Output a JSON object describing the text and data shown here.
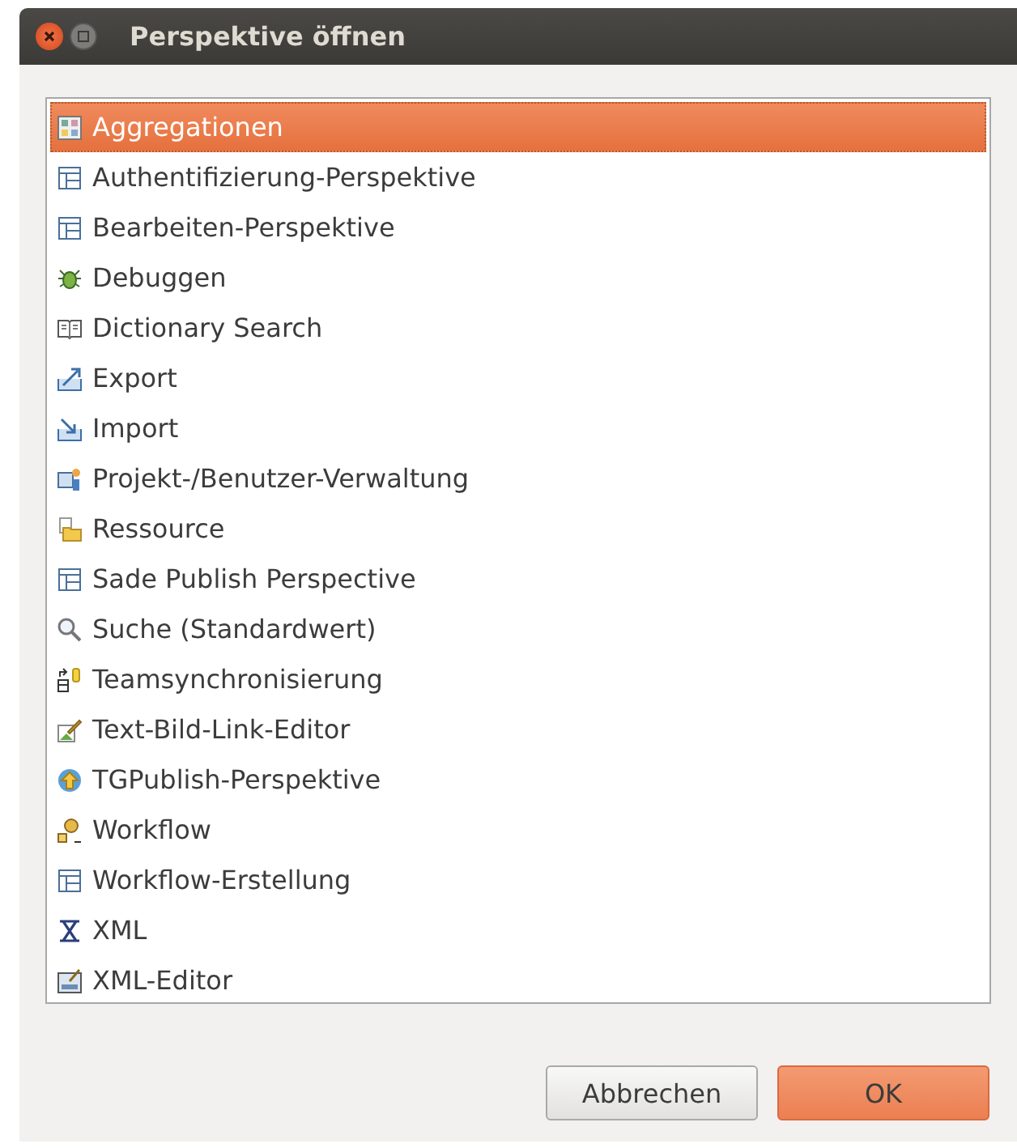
{
  "window": {
    "title": "Perspektive öffnen"
  },
  "perspectives": [
    {
      "label": "Aggregationen",
      "selected": true,
      "kind": "grid"
    },
    {
      "label": "Authentifizierung-Perspektive",
      "selected": false,
      "kind": "table"
    },
    {
      "label": "Bearbeiten-Perspektive",
      "selected": false,
      "kind": "table"
    },
    {
      "label": "Debuggen",
      "selected": false,
      "kind": "bug"
    },
    {
      "label": "Dictionary Search",
      "selected": false,
      "kind": "book"
    },
    {
      "label": "Export",
      "selected": false,
      "kind": "export"
    },
    {
      "label": "Import",
      "selected": false,
      "kind": "import"
    },
    {
      "label": "Projekt-/Benutzer-Verwaltung",
      "selected": false,
      "kind": "users"
    },
    {
      "label": "Ressource",
      "selected": false,
      "kind": "folder"
    },
    {
      "label": "Sade Publish Perspective",
      "selected": false,
      "kind": "table"
    },
    {
      "label": "Suche (Standardwert)",
      "selected": false,
      "kind": "search"
    },
    {
      "label": "Teamsynchronisierung",
      "selected": false,
      "kind": "sync"
    },
    {
      "label": "Text-Bild-Link-Editor",
      "selected": false,
      "kind": "editor"
    },
    {
      "label": "TGPublish-Perspektive",
      "selected": false,
      "kind": "globe"
    },
    {
      "label": "Workflow",
      "selected": false,
      "kind": "workflow"
    },
    {
      "label": "Workflow-Erstellung",
      "selected": false,
      "kind": "table"
    },
    {
      "label": "XML",
      "selected": false,
      "kind": "x"
    },
    {
      "label": "XML-Editor",
      "selected": false,
      "kind": "xml"
    }
  ],
  "buttons": [
    {
      "label": "Abbrechen",
      "kind": "cancel"
    },
    {
      "label": "OK",
      "kind": "default"
    }
  ]
}
